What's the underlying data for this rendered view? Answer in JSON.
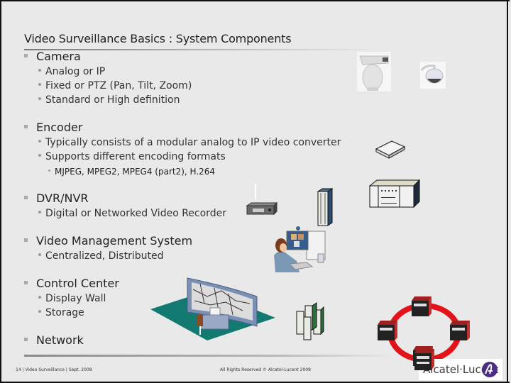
{
  "slide": {
    "title": "Video Surveillance Basics : System Components",
    "sections": [
      {
        "heading": "Camera",
        "items": [
          "Analog or IP",
          "Fixed or PTZ (Pan, Tilt, Zoom)",
          "Standard or High definition"
        ]
      },
      {
        "heading": "Encoder",
        "items": [
          "Typically consists of a modular analog to IP video converter",
          "Supports different encoding formats"
        ],
        "subitems": [
          "MJPEG, MPEG2, MPEG4 (part2), H.264"
        ]
      },
      {
        "heading": "DVR/NVR",
        "items": [
          "Digital or Networked Video Recorder"
        ]
      },
      {
        "heading": "Video Management System",
        "items": [
          "Centralized, Distributed"
        ]
      },
      {
        "heading": "Control Center",
        "items": [
          "Display Wall",
          "Storage"
        ]
      },
      {
        "heading": "Network",
        "items": []
      }
    ]
  },
  "footer": {
    "left": "14 | Video Surveillance | Sept. 2008",
    "center": "All Rights Reserved © Alcatel-Lucent 2008",
    "logo_text": "Alcatel·Lucent"
  },
  "colors": {
    "background": "#e9e9e9",
    "ring_red": "#e3131b",
    "floor_teal": "#137a72",
    "logo_purple": "#4b2e83"
  }
}
